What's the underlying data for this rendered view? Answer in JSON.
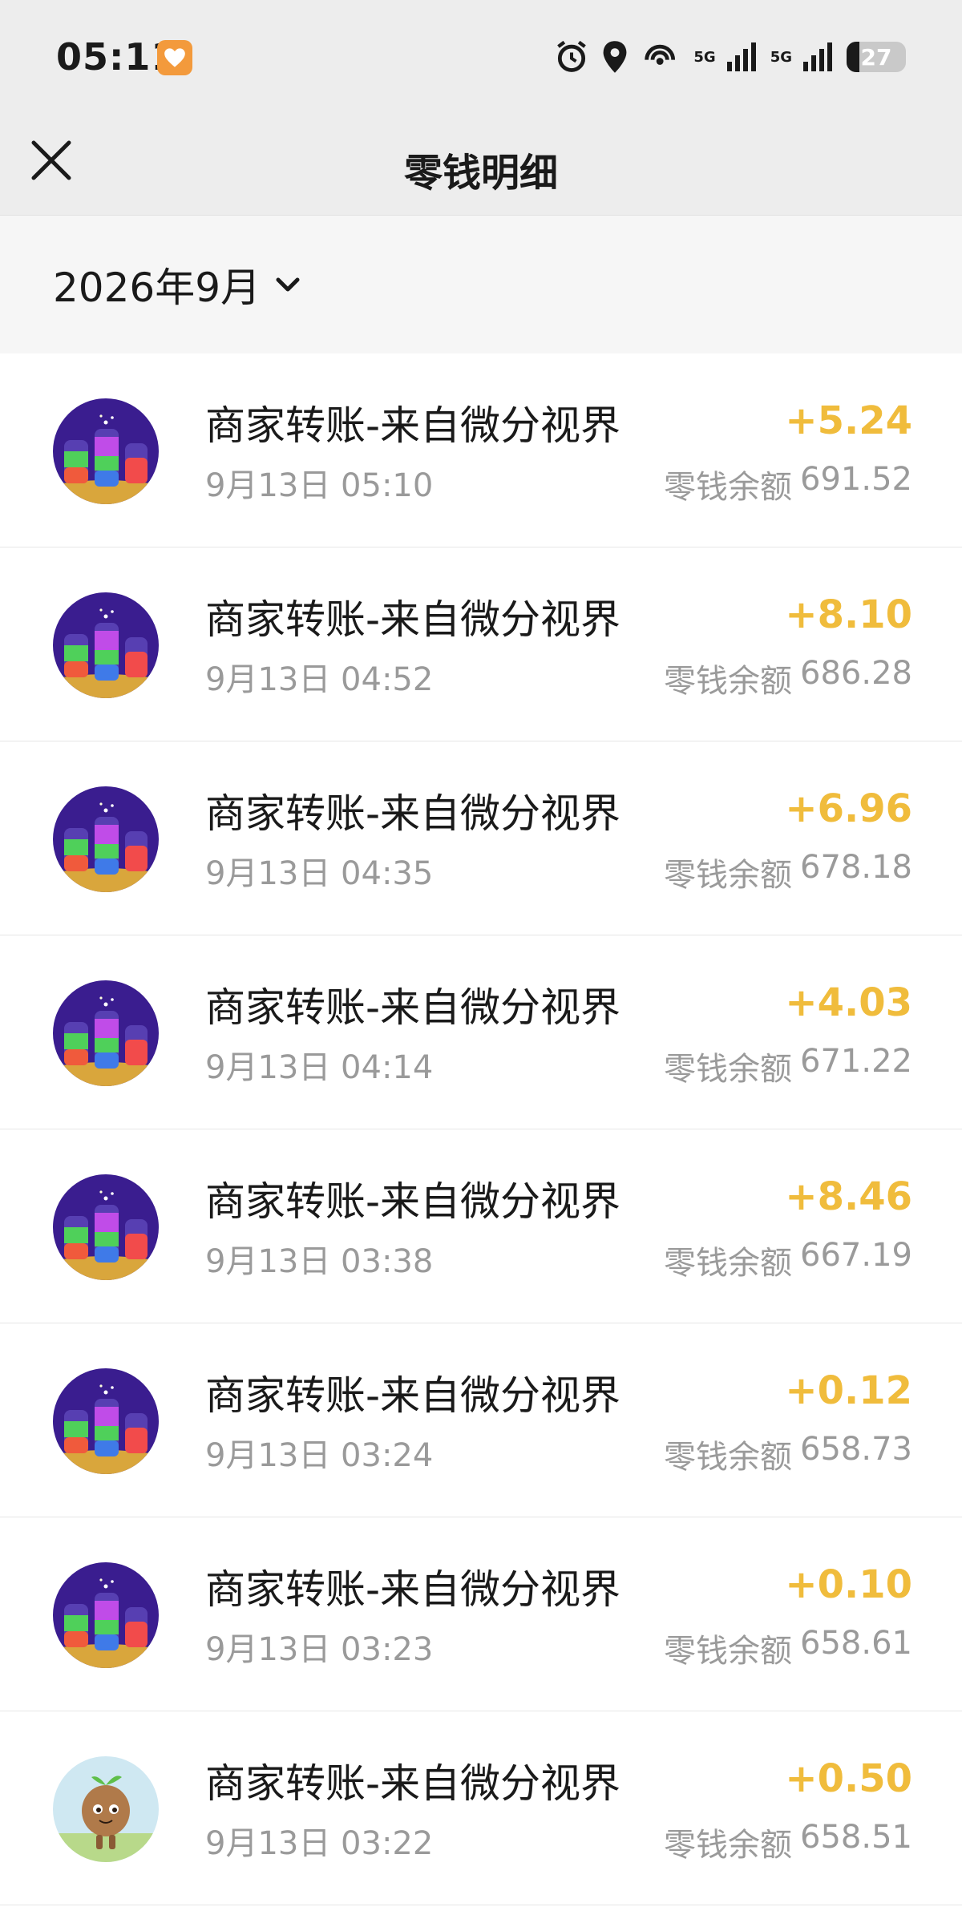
{
  "status_bar": {
    "time": "05:11",
    "network_1": "5G",
    "network_2": "5G",
    "battery": "27",
    "icons": [
      "app-heart-icon",
      "alarm-icon",
      "location-icon",
      "hotspot-icon",
      "signal-icon",
      "battery-icon"
    ]
  },
  "header": {
    "title": "零钱明细",
    "close_icon": "close-icon"
  },
  "filter": {
    "month": "2026年9月",
    "dropdown_icon": "chevron-down-icon"
  },
  "transactions": [
    {
      "title": "商家转账-来自微分视界",
      "time": "9月13日 05:10",
      "amount": "+5.24",
      "balance_label": "零钱余额",
      "balance": "691.52",
      "avatar": "bottles-avatar"
    },
    {
      "title": "商家转账-来自微分视界",
      "time": "9月13日 04:52",
      "amount": "+8.10",
      "balance_label": "零钱余额",
      "balance": "686.28",
      "avatar": "bottles-avatar"
    },
    {
      "title": "商家转账-来自微分视界",
      "time": "9月13日 04:35",
      "amount": "+6.96",
      "balance_label": "零钱余额",
      "balance": "678.18",
      "avatar": "bottles-avatar"
    },
    {
      "title": "商家转账-来自微分视界",
      "time": "9月13日 04:14",
      "amount": "+4.03",
      "balance_label": "零钱余额",
      "balance": "671.22",
      "avatar": "bottles-avatar"
    },
    {
      "title": "商家转账-来自微分视界",
      "time": "9月13日 03:38",
      "amount": "+8.46",
      "balance_label": "零钱余额",
      "balance": "667.19",
      "avatar": "bottles-avatar"
    },
    {
      "title": "商家转账-来自微分视界",
      "time": "9月13日 03:24",
      "amount": "+0.12",
      "balance_label": "零钱余额",
      "balance": "658.73",
      "avatar": "bottles-avatar"
    },
    {
      "title": "商家转账-来自微分视界",
      "time": "9月13日 03:23",
      "amount": "+0.10",
      "balance_label": "零钱余额",
      "balance": "658.61",
      "avatar": "bottles-avatar"
    },
    {
      "title": "商家转账-来自微分视界",
      "time": "9月13日 03:22",
      "amount": "+0.50",
      "balance_label": "零钱余额",
      "balance": "658.51",
      "avatar": "sprout-character-avatar"
    }
  ],
  "colors": {
    "amount": "#f0bc3c",
    "secondary_text": "#9a9a9a",
    "header_bg": "#ededed"
  }
}
